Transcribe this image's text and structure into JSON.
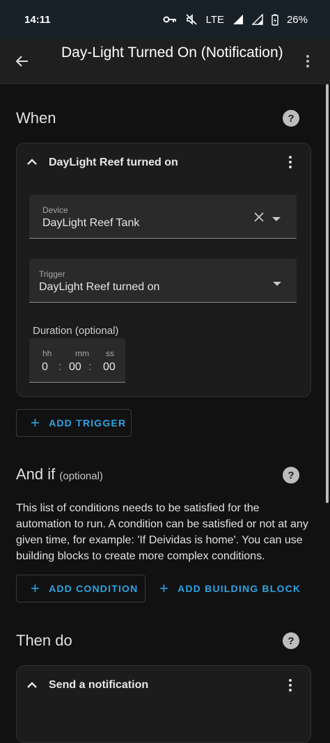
{
  "status_bar": {
    "time": "14:11",
    "network": "LTE",
    "battery": "26%",
    "icons": [
      "key-icon",
      "mute-icon",
      "signal-icon",
      "signal-icon",
      "battery-charging-icon"
    ]
  },
  "app_bar": {
    "title": "Day-Light Turned On (Notification)",
    "back_icon": "arrow-left-icon",
    "menu_icon": "more-vert-icon"
  },
  "when": {
    "title": "When",
    "help_icon": "help-circle-icon",
    "trigger_card": {
      "title": "DayLight Reef turned on",
      "device_field": {
        "label": "Device",
        "value": "DayLight Reef Tank"
      },
      "trigger_field": {
        "label": "Trigger",
        "value": "DayLight Reef turned on"
      },
      "duration": {
        "label": "Duration (optional)",
        "hh_label": "hh",
        "hh_value": "0",
        "mm_label": "mm",
        "mm_value": "00",
        "ss_label": "ss",
        "ss_value": "00",
        "separator": ":"
      }
    },
    "add_trigger_label": "ADD TRIGGER"
  },
  "and_if": {
    "title": "And if",
    "optional": "(optional)",
    "description": "This list of conditions needs to be satisfied for the automation to run. A condition can be satisfied or not at any given time, for example: 'If Deividas is home'. You can use building blocks to create more complex conditions.",
    "add_condition_label": "ADD CONDITION",
    "add_building_block_label": "ADD BUILDING BLOCK"
  },
  "then_do": {
    "title": "Then do",
    "action_card_title": "Send a notification"
  },
  "colors": {
    "accent": "#2aa5e6",
    "background": "#111111",
    "status_bar": "#172127",
    "app_bar": "#1f1f1f"
  }
}
